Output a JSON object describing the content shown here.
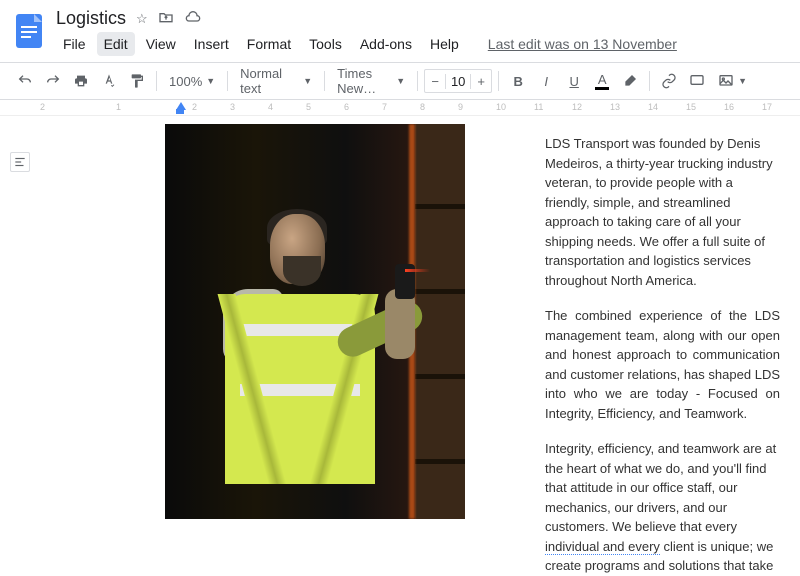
{
  "doc": {
    "title": "Logistics"
  },
  "menu": {
    "file": "File",
    "edit": "Edit",
    "view": "View",
    "insert": "Insert",
    "format": "Format",
    "tools": "Tools",
    "addons": "Add-ons",
    "help": "Help"
  },
  "lastEdit": "Last edit was on 13 November",
  "toolbar": {
    "zoom": "100%",
    "style": "Normal text",
    "font": "Times New…",
    "fontSize": "10"
  },
  "ruler": [
    "2",
    "",
    "1",
    "",
    "2",
    "3",
    "4",
    "5",
    "6",
    "7",
    "8",
    "9",
    "10",
    "11",
    "12",
    "13",
    "14",
    "15",
    "16",
    "17"
  ],
  "content": {
    "p1": "LDS Transport was founded by Denis Medeiros, a thirty-year trucking industry veteran, to provide people with a friendly, simple, and streamlined approach to taking care of all your shipping needs. We offer a full suite of transportation and logistics services throughout North America.",
    "p2": "The combined experience of the LDS management team, along with our open and honest approach to communication and customer relations, has shaped LDS into who we are today - Focused on Integrity, Efficiency, and Teamwork.",
    "p3a": "Integrity, efficiency, and teamwork are at the heart of what we do, and you'll find that attitude in  our  office staff, our mechanics, our drivers, and our customers. We believe that every ",
    "p3b": "individual and every",
    "p3c": " client is unique; we create programs and solutions that take"
  }
}
